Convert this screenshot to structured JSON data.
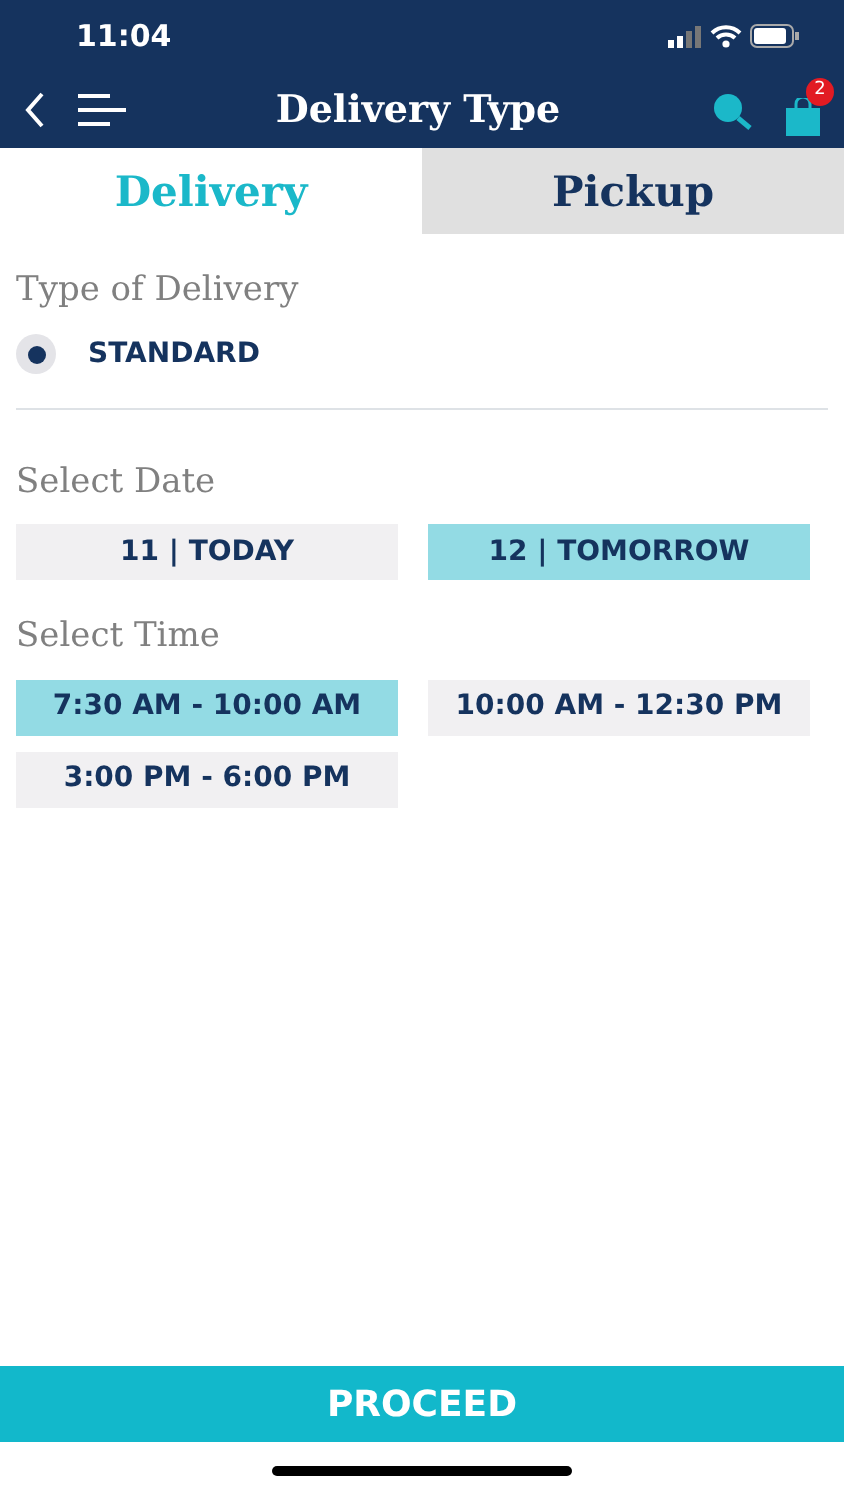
{
  "status_bar": {
    "time": "11:04"
  },
  "header": {
    "title": "Delivery Type",
    "cart_count": "2"
  },
  "tabs": [
    {
      "label": "Delivery",
      "selected": true
    },
    {
      "label": "Pickup",
      "selected": false
    }
  ],
  "delivery_type": {
    "heading": "Type of Delivery",
    "options": [
      {
        "label": "STANDARD",
        "selected": true
      }
    ]
  },
  "date": {
    "heading": "Select Date",
    "options": [
      {
        "label": "11 | TODAY",
        "selected": false
      },
      {
        "label": "12 | TOMORROW",
        "selected": true
      }
    ]
  },
  "time": {
    "heading": "Select Time",
    "options": [
      {
        "label": "7:30 AM - 10:00 AM",
        "selected": true
      },
      {
        "label": "10:00 AM - 12:30 PM",
        "selected": false
      },
      {
        "label": "3:00 PM - 6:00 PM",
        "selected": false
      }
    ]
  },
  "proceed_button": "PROCEED"
}
